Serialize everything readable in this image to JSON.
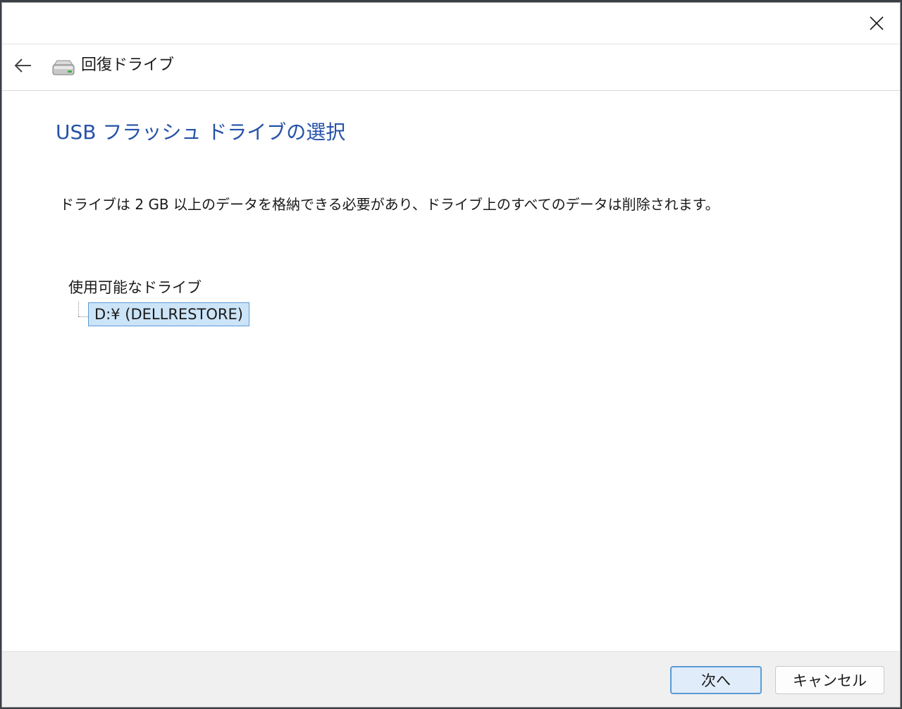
{
  "window": {
    "close_icon": "close-icon"
  },
  "nav": {
    "back_icon": "back-arrow-icon",
    "app_icon": "drive-icon",
    "title": "回復ドライブ"
  },
  "main": {
    "heading": "USB フラッシュ ドライブの選択",
    "description": "ドライブは 2 GB 以上のデータを格納できる必要があり、ドライブ上のすべてのデータは削除されます。",
    "tree": {
      "root_label": "使用可能なドライブ",
      "items": [
        {
          "label": "D:¥ (DELLRESTORE)",
          "selected": true
        }
      ]
    }
  },
  "footer": {
    "next_label": "次へ",
    "cancel_label": "キャンセル"
  },
  "colors": {
    "heading": "#2552a8",
    "selection_bg": "#cce4f7",
    "selection_border": "#5b9bd5",
    "footer_bg": "#f0f0f0"
  }
}
